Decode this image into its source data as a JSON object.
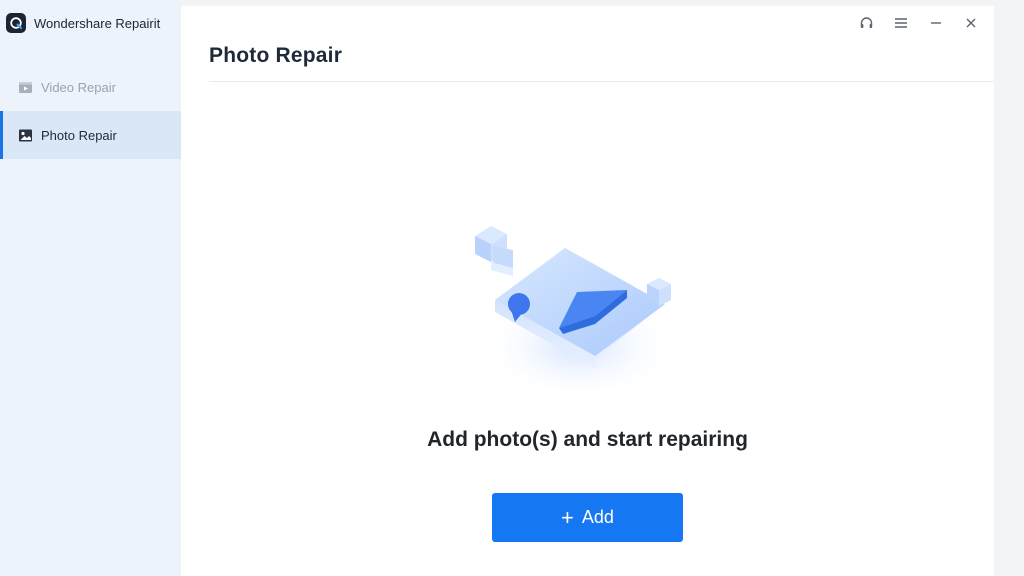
{
  "app": {
    "title": "Wondershare Repairit"
  },
  "sidebar": {
    "items": [
      {
        "label": "Video Repair",
        "icon": "video-icon",
        "active": false
      },
      {
        "label": "Photo Repair",
        "icon": "photo-icon",
        "active": true
      }
    ]
  },
  "window_controls": [
    "headset-icon",
    "menu-icon",
    "minimize-icon",
    "close-icon"
  ],
  "main": {
    "title": "Photo Repair",
    "prompt": "Add photo(s) and start repairing",
    "add_button": {
      "plus": "+",
      "label": "Add"
    }
  },
  "colors": {
    "accent": "#1677f2",
    "sidebar_bg": "#edf3fb",
    "sidebar_active_bg": "#dae7f6",
    "illustration_blue": "#3f7df0"
  }
}
